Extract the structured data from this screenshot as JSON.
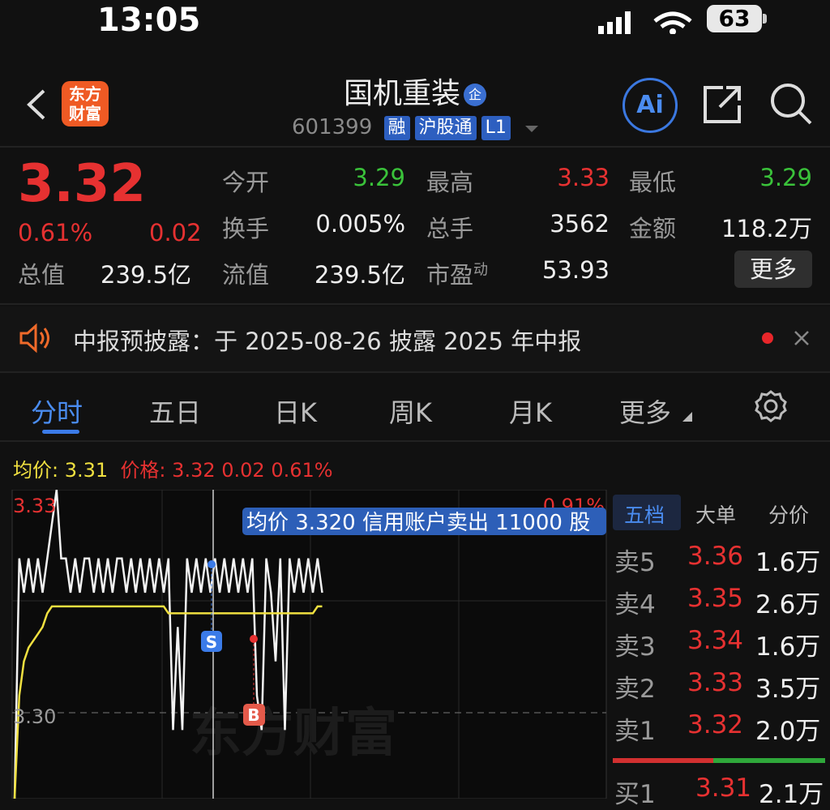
{
  "status_bar": {
    "time": "13:05",
    "battery": "63"
  },
  "header": {
    "logo_text": "东方财富",
    "title": "国机重装",
    "title_badge": "企",
    "code": "601399",
    "tags": [
      "融",
      "沪股通",
      "L1"
    ],
    "ai_label": "Ai"
  },
  "quote": {
    "price": "3.32",
    "change_pct": "0.61%",
    "change": "0.02",
    "total_value_label": "总值",
    "total_value": "239.5亿",
    "open_label": "今开",
    "open": "3.29",
    "high_label": "最高",
    "high": "3.33",
    "low_label": "最低",
    "low": "3.29",
    "turnover_label": "换手",
    "turnover": "0.005%",
    "volume_label": "总手",
    "volume": "3562",
    "amount_label": "金额",
    "amount": "118.2万",
    "float_value_label": "流值",
    "float_value": "239.5亿",
    "pe_label": "市盈",
    "pe_sup": "动",
    "pe": "53.93",
    "more_label": "更多"
  },
  "notice": {
    "text": "中报预披露：于 2025-08-26 披露 2025 年中报"
  },
  "tabs": [
    "分时",
    "五日",
    "日K",
    "周K",
    "月K",
    "更多"
  ],
  "chart_legend": {
    "avg_label": "均价:",
    "avg": "3.31",
    "price_label": "价格:",
    "price": "3.32",
    "change": "0.02",
    "change_pct": "0.61%"
  },
  "chart_data": {
    "type": "line",
    "y_top_label": "3.33",
    "y_bottom_label": "3.30",
    "pct_top_label": "0.91%",
    "tooltip": "均价 3.320 信用账户卖出 11000 股",
    "watermark": "东方财富",
    "markers": [
      "S",
      "B"
    ],
    "ylim": [
      3.29,
      3.335
    ],
    "series": [
      {
        "values": [
          3.29,
          3.325,
          3.32,
          3.325,
          3.32,
          3.325,
          3.32,
          3.325,
          3.33,
          3.335,
          3.325,
          3.325,
          3.32,
          3.325,
          3.32,
          3.325,
          3.325,
          3.32,
          3.325,
          3.32,
          3.325,
          3.32,
          3.325,
          3.325,
          3.32,
          3.325,
          3.32,
          3.325,
          3.32,
          3.325,
          3.32,
          3.325,
          3.32,
          3.325,
          3.3,
          3.315,
          3.3,
          3.325,
          3.32,
          3.325,
          3.32,
          3.325,
          3.32,
          3.325,
          3.32,
          3.325,
          3.32,
          3.325,
          3.32,
          3.325,
          3.32,
          3.325,
          3.305,
          3.3,
          3.325,
          3.32,
          3.31,
          3.325,
          3.3,
          3.325,
          3.32,
          3.325,
          3.32,
          3.325,
          3.32,
          3.325,
          3.32
        ]
      },
      {
        "values": [
          3.29,
          3.305,
          3.31,
          3.312,
          3.313,
          3.314,
          3.315,
          3.317,
          3.318,
          3.318,
          3.318,
          3.318,
          3.318,
          3.318,
          3.318,
          3.318,
          3.318,
          3.318,
          3.318,
          3.318,
          3.318,
          3.318,
          3.318,
          3.318,
          3.318,
          3.318,
          3.318,
          3.318,
          3.318,
          3.318,
          3.318,
          3.318,
          3.318,
          3.317,
          3.317,
          3.317,
          3.317,
          3.317,
          3.317,
          3.317,
          3.317,
          3.317,
          3.317,
          3.317,
          3.317,
          3.317,
          3.317,
          3.317,
          3.317,
          3.317,
          3.317,
          3.317,
          3.317,
          3.317,
          3.317,
          3.317,
          3.317,
          3.317,
          3.317,
          3.317,
          3.317,
          3.317,
          3.317,
          3.317,
          3.317,
          3.318,
          3.318
        ]
      }
    ]
  },
  "order_book": {
    "tabs": [
      "五档",
      "大单",
      "分价"
    ],
    "asks": [
      {
        "label": "卖5",
        "price": "3.36",
        "vol": "1.6万"
      },
      {
        "label": "卖4",
        "price": "3.35",
        "vol": "2.6万"
      },
      {
        "label": "卖3",
        "price": "3.34",
        "vol": "1.6万"
      },
      {
        "label": "卖2",
        "price": "3.33",
        "vol": "3.5万"
      },
      {
        "label": "卖1",
        "price": "3.32",
        "vol": "2.0万"
      }
    ],
    "bid1": {
      "label": "买1",
      "price": "3.31",
      "vol": "2.1万"
    }
  },
  "colors": {
    "up": "#e63131",
    "down": "#3ac23a",
    "avg_line": "#f0e040",
    "accent": "#2d5fc0"
  }
}
